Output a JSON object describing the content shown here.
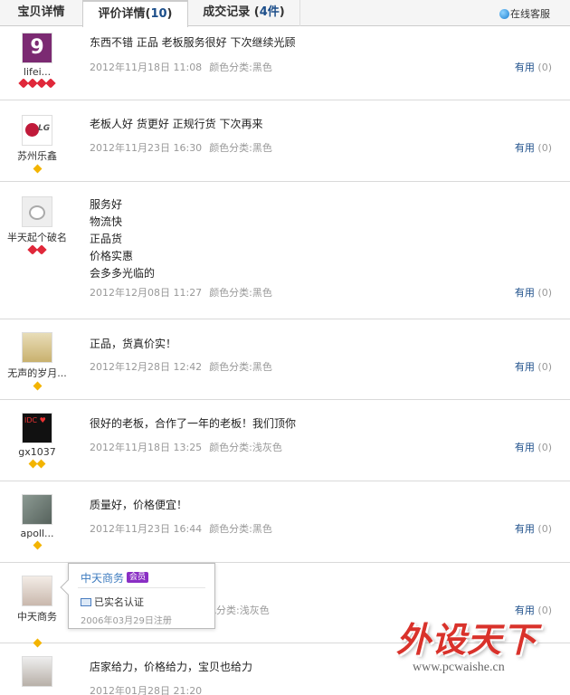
{
  "tabs": [
    {
      "label": "宝贝详情"
    },
    {
      "label": "评价详情",
      "count": "10"
    },
    {
      "label": "成交记录",
      "count": "4件"
    }
  ],
  "online_service": "在线客服",
  "useful_label": "有用",
  "useful_count": "(0)",
  "color_prefix": "颜色分类:",
  "reviews": [
    {
      "user": "lifei...",
      "content": [
        "东西不错 正品 老板服务很好 下次继续光顾"
      ],
      "date": "2012年11月18日 11:08",
      "color": "黑色",
      "rank": "hearts4"
    },
    {
      "user": "苏州乐鑫",
      "content": [
        "老板人好 货更好 正规行货 下次再来"
      ],
      "date": "2012年11月23日 16:30",
      "color": "黑色",
      "rank": "diamond1"
    },
    {
      "user": "半天起个破名",
      "content": [
        "服务好",
        "物流快",
        "正品货",
        "价格实惠",
        "会多多光临的"
      ],
      "date": "2012年12月08日 11:27",
      "color": "黑色",
      "rank": "hearts2"
    },
    {
      "user": "无声的岁月...",
      "content": [
        "正品，货真价实！"
      ],
      "date": "2012年12月28日 12:42",
      "color": "黑色",
      "rank": "diamond1"
    },
    {
      "user": "gx1037",
      "content": [
        "很好的老板，合作了一年的老板！我们顶你"
      ],
      "date": "2012年11月18日 13:25",
      "color": "浅灰色",
      "rank": "diamond2"
    },
    {
      "user": "apoll...",
      "content": [
        "质量好，价格便宜！"
      ],
      "date": "2012年11月23日 16:44",
      "color": "黑色",
      "rank": "diamond1"
    },
    {
      "user": "中天商务",
      "content": [
        ""
      ],
      "date": "",
      "color": "浅灰色",
      "rank": "diamond1"
    },
    {
      "user": "",
      "content": [
        "店家给力，价格给力，宝贝也给力"
      ],
      "date": "2012年01月28日 21:20",
      "color": "",
      "rank": ""
    }
  ],
  "popup": {
    "name": "中天商务",
    "vip": "会员",
    "verified": "已实名认证",
    "registered": "2006年03月29日注册"
  },
  "watermark": {
    "title": "外设天下",
    "url": "www.pcwaishe.cn"
  }
}
